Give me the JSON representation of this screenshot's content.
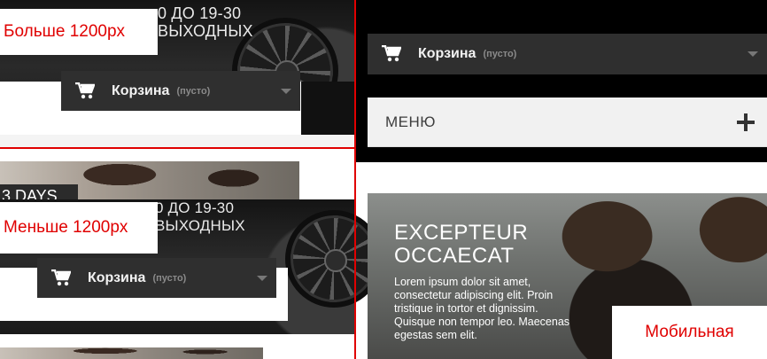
{
  "desktop_large": {
    "label": "Больше 1200px",
    "promo_line1": "0 ДО 19-30",
    "promo_line2": "ВЫХОДНЫХ",
    "cart_label": "Корзина",
    "cart_status": "(пусто)"
  },
  "desktop_small": {
    "label": "Меньше 1200px",
    "badge_text": "3 DAYS",
    "promo_line1": "0 ДО 19-30",
    "promo_line2": "ВЫХОДНЫХ",
    "cart_label": "Корзина",
    "cart_status": "(пусто)"
  },
  "mobile": {
    "label": "Мобильная",
    "cart_label": "Корзина",
    "cart_status": "(пусто)",
    "menu_label": "МЕНЮ",
    "hero_title_line1": "EXCEPTEUR",
    "hero_title_line2": "OCCAECAT",
    "hero_body": "Lorem ipsum dolor sit amet, consectetur adipiscing elit. Proin tristique in tortor et dignissim. Quisque non tempor leo. Maecenas egestas sem elit."
  },
  "colors": {
    "divider_red": "#e00000",
    "label_red": "#e00000",
    "cart_bg": "#2f2f2f",
    "menu_bg": "#f1f1f1"
  },
  "icons": [
    "cart-icon",
    "caret-down-icon",
    "plus-icon"
  ]
}
